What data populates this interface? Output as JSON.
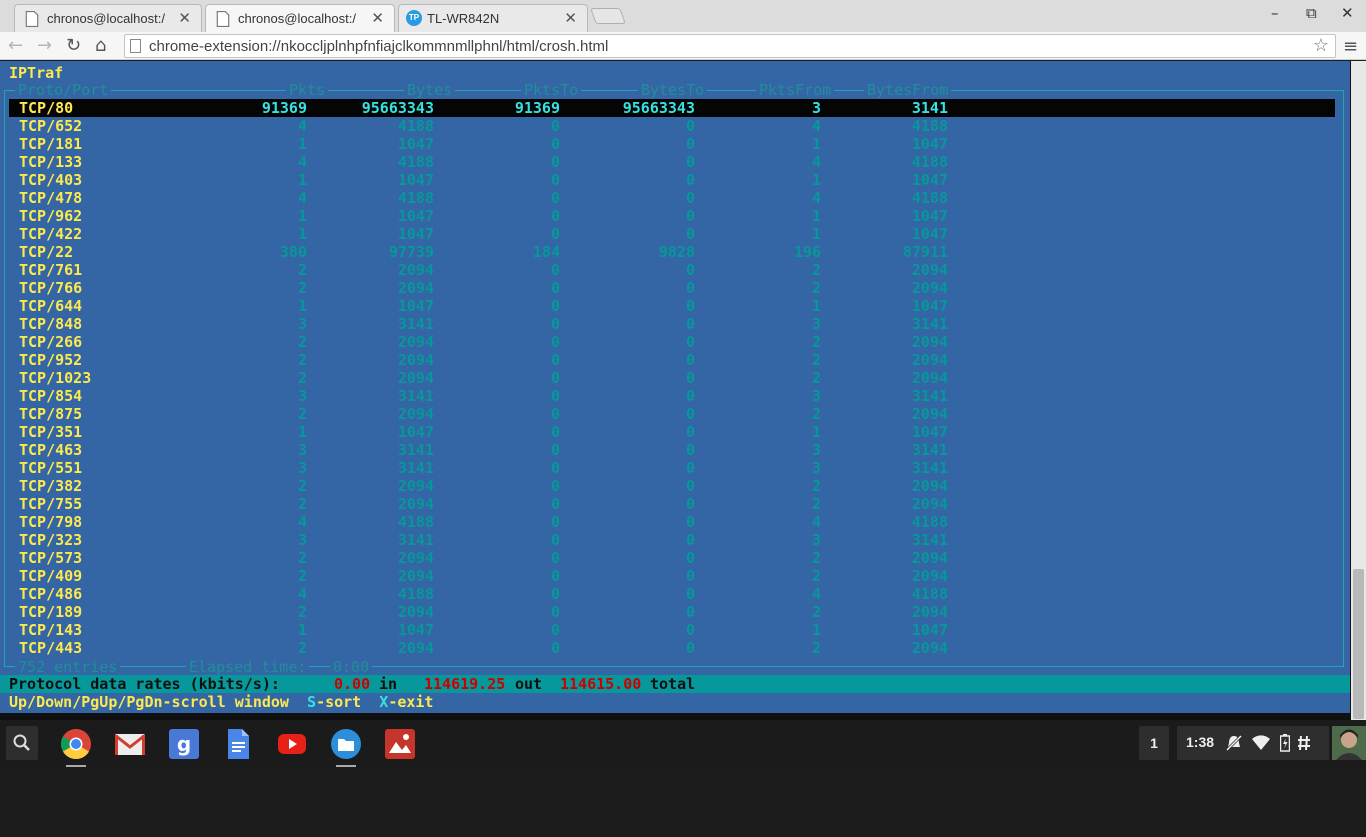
{
  "browser": {
    "tabs": [
      {
        "title": "chronos@localhost:/",
        "close": "✕"
      },
      {
        "title": "chronos@localhost:/",
        "close": "✕"
      },
      {
        "title": "TL-WR842N",
        "close": "✕",
        "favicon_text": "TP"
      }
    ],
    "window": {
      "minimize": "–",
      "restore": "⧉",
      "close": "✕"
    },
    "nav": {
      "back": "←",
      "forward": "→",
      "reload": "↻",
      "home": "⌂",
      "menu": "≡",
      "star": "☆"
    },
    "url": "chrome-extension://nkoccljplnhpfnfiajclkommnmllphnl/html/crosh.html"
  },
  "terminal": {
    "app_title": "IPTraf",
    "headers": {
      "proto": "Proto/Port",
      "pkts": "Pkts",
      "bytes": "Bytes",
      "pktsto": "PktsTo",
      "bytesto": "BytesTo",
      "pktsfrom": "PktsFrom",
      "bytesfrom": "BytesFrom"
    },
    "rows": [
      [
        "TCP/80",
        "91369",
        "95663343",
        "91369",
        "95663343",
        "3",
        "3141"
      ],
      [
        "TCP/652",
        "4",
        "4188",
        "0",
        "0",
        "4",
        "4188"
      ],
      [
        "TCP/181",
        "1",
        "1047",
        "0",
        "0",
        "1",
        "1047"
      ],
      [
        "TCP/133",
        "4",
        "4188",
        "0",
        "0",
        "4",
        "4188"
      ],
      [
        "TCP/403",
        "1",
        "1047",
        "0",
        "0",
        "1",
        "1047"
      ],
      [
        "TCP/478",
        "4",
        "4188",
        "0",
        "0",
        "4",
        "4188"
      ],
      [
        "TCP/962",
        "1",
        "1047",
        "0",
        "0",
        "1",
        "1047"
      ],
      [
        "TCP/422",
        "1",
        "1047",
        "0",
        "0",
        "1",
        "1047"
      ],
      [
        "TCP/22",
        "380",
        "97739",
        "184",
        "9828",
        "196",
        "87911"
      ],
      [
        "TCP/761",
        "2",
        "2094",
        "0",
        "0",
        "2",
        "2094"
      ],
      [
        "TCP/766",
        "2",
        "2094",
        "0",
        "0",
        "2",
        "2094"
      ],
      [
        "TCP/644",
        "1",
        "1047",
        "0",
        "0",
        "1",
        "1047"
      ],
      [
        "TCP/848",
        "3",
        "3141",
        "0",
        "0",
        "3",
        "3141"
      ],
      [
        "TCP/266",
        "2",
        "2094",
        "0",
        "0",
        "2",
        "2094"
      ],
      [
        "TCP/952",
        "2",
        "2094",
        "0",
        "0",
        "2",
        "2094"
      ],
      [
        "TCP/1023",
        "2",
        "2094",
        "0",
        "0",
        "2",
        "2094"
      ],
      [
        "TCP/854",
        "3",
        "3141",
        "0",
        "0",
        "3",
        "3141"
      ],
      [
        "TCP/875",
        "2",
        "2094",
        "0",
        "0",
        "2",
        "2094"
      ],
      [
        "TCP/351",
        "1",
        "1047",
        "0",
        "0",
        "1",
        "1047"
      ],
      [
        "TCP/463",
        "3",
        "3141",
        "0",
        "0",
        "3",
        "3141"
      ],
      [
        "TCP/551",
        "3",
        "3141",
        "0",
        "0",
        "3",
        "3141"
      ],
      [
        "TCP/382",
        "2",
        "2094",
        "0",
        "0",
        "2",
        "2094"
      ],
      [
        "TCP/755",
        "2",
        "2094",
        "0",
        "0",
        "2",
        "2094"
      ],
      [
        "TCP/798",
        "4",
        "4188",
        "0",
        "0",
        "4",
        "4188"
      ],
      [
        "TCP/323",
        "3",
        "3141",
        "0",
        "0",
        "3",
        "3141"
      ],
      [
        "TCP/573",
        "2",
        "2094",
        "0",
        "0",
        "2",
        "2094"
      ],
      [
        "TCP/409",
        "2",
        "2094",
        "0",
        "0",
        "2",
        "2094"
      ],
      [
        "TCP/486",
        "4",
        "4188",
        "0",
        "0",
        "4",
        "4188"
      ],
      [
        "TCP/189",
        "2",
        "2094",
        "0",
        "0",
        "2",
        "2094"
      ],
      [
        "TCP/143",
        "1",
        "1047",
        "0",
        "0",
        "1",
        "1047"
      ],
      [
        "TCP/443",
        "2",
        "2094",
        "0",
        "0",
        "2",
        "2094"
      ]
    ],
    "footer": {
      "entries": "752 entries",
      "elapsed_label": "Elapsed time:",
      "elapsed_value": "0:00"
    },
    "rates": {
      "label": "Protocol data rates (kbits/s):",
      "in_value": "0.00",
      "in_label": "in",
      "out_value": "114619.25",
      "out_label": "out",
      "total_value": "114615.00",
      "total_label": "total"
    },
    "help": {
      "scroll_keys": "Up/Down/PgUp/PgDn",
      "scroll_desc": "-scroll window",
      "sort_key": "S",
      "sort_desc": "-sort",
      "exit_key": "X",
      "exit_desc": "-exit"
    }
  },
  "shelf": {
    "apps": [
      "search-icon",
      "chrome-icon",
      "gmail-icon",
      "google-search-icon",
      "docs-icon",
      "youtube-icon",
      "files-icon",
      "photos-icon"
    ],
    "notification_count": "1",
    "time": "1:38"
  },
  "colors": {
    "terminal_bg": "#3465a4",
    "yellow": "#fce94f",
    "cyan": "#06989a",
    "red": "#cc0000"
  }
}
